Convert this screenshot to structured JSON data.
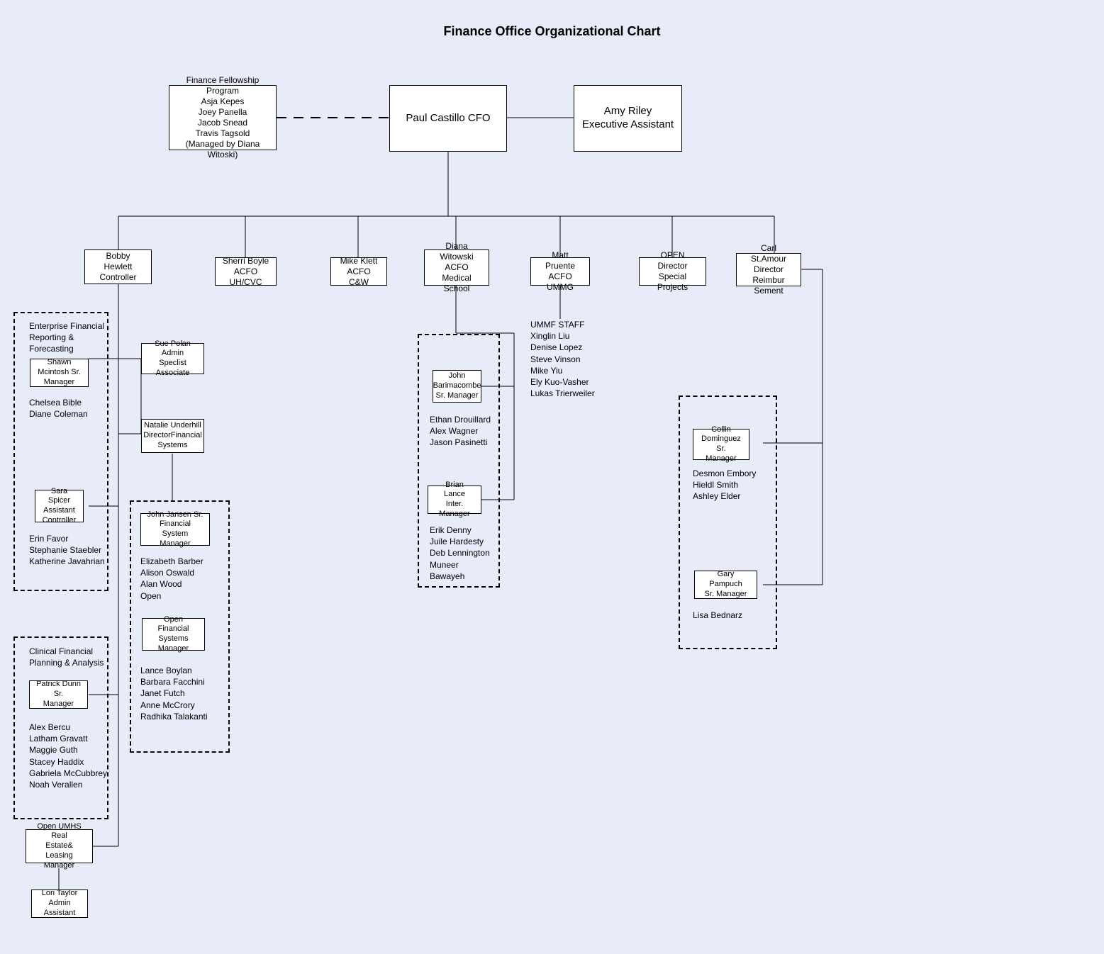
{
  "title": "Finance Office Organizational Chart",
  "top": {
    "fellowship": "Finance Fellowship Program\nAsja Kepes\nJoey Panella\nJacob Snead\nTravis Tagsold\n(Managed by Diana Witoski)",
    "cfo": "Paul Castillo CFO",
    "exec_assist": "Amy Riley\nExecutive Assistant"
  },
  "row2": {
    "controller": "Bobby Hewlett\nController",
    "acfo_uhcvc": "Sherri Boyle\nACFO UH/CVC",
    "acfo_cw": "Mike Klett\nACFO C&W",
    "acfo_med": "Diana Witowski\nACFO Medical\nSchool",
    "acfo_ummg": "Matt Pruente\nACFO UMMG",
    "open_dir": "OPEN Director\nSpecial Projects",
    "stamour": "Carl St.Amour\nDirector\nReimbur Sement"
  },
  "controller_group": {
    "efr_header": "Enterprise Financial\nReporting &\nForecasting",
    "shawn": "Shawn Mcintosh Sr.\nManager",
    "efr_staff": "Chelsea Bible\nDiane Coleman",
    "sara": "Sara Spicer\nAssistant\nController",
    "sara_staff": "Erin Favor\nStephanie Staebler\nKatherine Javahrian",
    "cfpa_header": "Clinical Financial\nPlanning & Analysis",
    "patrick": "Patrick Dunn Sr.\nManager",
    "cfpa_staff": "Alex Bercu\nLatham Gravatt\nMaggie Guth\nStacey Haddix\nGabriela McCubbrey\nNoah Verallen",
    "realestate": "Open UMHS Real\nEstate& Leasing\nManager",
    "lori": "Lori Taylor\nAdmin Assistant"
  },
  "controller_side": {
    "sue": "Sue Polan\nAdmin Speclist\nAssociate",
    "natalie": "Natalie Underhill\nDirectorFinancial\nSystems"
  },
  "fin_systems_group": {
    "jansen": "John Jansen Sr.\nFinancial System\nManager",
    "jansen_staff": "Elizabeth Barber\nAlison Oswald\nAlan Wood\nOpen",
    "open_fsm": "Open Financial\nSystems\nManager",
    "open_fsm_staff": "Lance Boylan\nBarbara Facchini\nJanet Futch\nAnne McCrory\nRadhika Talakanti"
  },
  "med_group": {
    "john_b": "John\nBarimacombe\nSr. Manager",
    "john_b_staff": "Ethan Drouillard\nAlex Wagner\nJason Pasinetti",
    "brian": "Brian Lance\nInter. Manager",
    "brian_staff": "Erik Denny\nJuile Hardesty\nDeb Lennington\nMuneer\nBawayeh"
  },
  "ummg_staff": "UMMF STAFF\nXinglin Liu\nDenise Lopez\nSteve Vinson\nMike Yiu\nEly Kuo-Vasher\nLukas Trierweiler",
  "reimb_group": {
    "collin": "Collin\nDominguez Sr.\nManager",
    "collin_staff": "Desmon Embory\nHieldl Smith\nAshley Elder",
    "gary": "Gary Pampuch\nSr. Manager",
    "gary_staff": "Lisa Bednarz"
  }
}
